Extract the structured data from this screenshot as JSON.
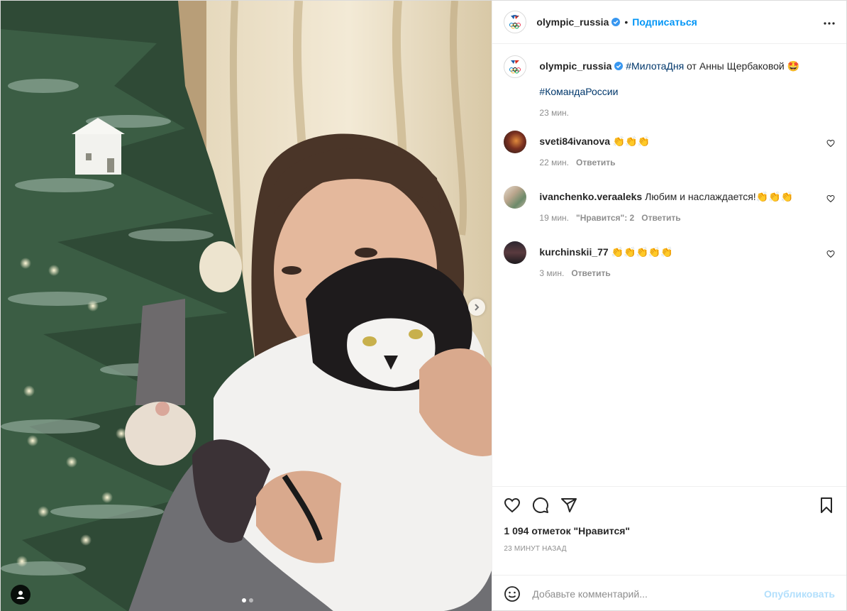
{
  "post": {
    "author": "olympic_russia",
    "follow_label": "Подписаться",
    "separator": "•",
    "more_label": "•••"
  },
  "caption": {
    "author": "olympic_russia",
    "hashtag1": "#МилотаДня",
    "text": " от Анны Щербаковой 🤩",
    "hashtag2": "#КомандаРоссии",
    "time": "23 мин."
  },
  "comments": [
    {
      "user": "sveti84ivanova",
      "text": " 👏👏👏",
      "time": "22 мин.",
      "likes": "",
      "reply": "Ответить",
      "avatar_color": "#3a2a22"
    },
    {
      "user": "ivanchenko.veraaleks",
      "text": " Любим и наслаждается!👏👏👏",
      "time": "19 мин.",
      "likes": "\"Нравится\": 2",
      "reply": "Ответить",
      "avatar_color": "#b9a58c"
    },
    {
      "user": "kurchinskii_77",
      "text": " 👏👏👏👏👏",
      "time": "3 мин.",
      "likes": "",
      "reply": "Ответить",
      "avatar_color": "#2c2630"
    }
  ],
  "stats": {
    "likes": "1 094 отметок \"Нравится\"",
    "posted": "23 минут назад"
  },
  "composer": {
    "placeholder": "Добавьте комментарий...",
    "publish_label": "Опубликовать"
  },
  "carousel": {
    "count": 2,
    "current": 1
  }
}
